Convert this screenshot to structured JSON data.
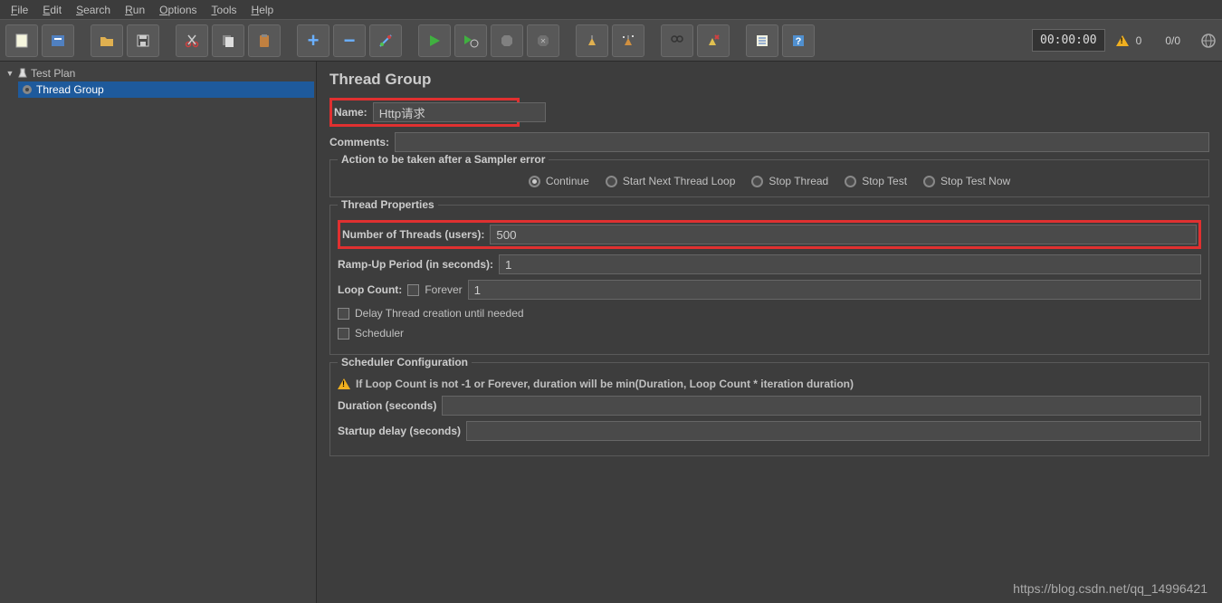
{
  "menu": {
    "file": "File",
    "edit": "Edit",
    "search": "Search",
    "run": "Run",
    "options": "Options",
    "tools": "Tools",
    "help": "Help"
  },
  "status": {
    "timer": "00:00:00",
    "warn": "0",
    "ratio": "0/0"
  },
  "tree": {
    "root": "Test Plan",
    "child": "Thread Group"
  },
  "panel": {
    "title": "Thread Group",
    "name_label": "Name:",
    "name_value": "Http请求",
    "comments_label": "Comments:",
    "action_legend": "Action to be taken after a Sampler error",
    "radios": {
      "continue": "Continue",
      "startnext": "Start Next Thread Loop",
      "stopthread": "Stop Thread",
      "stoptest": "Stop Test",
      "stoptestnow": "Stop Test Now"
    },
    "thread_legend": "Thread Properties",
    "num_threads_label": "Number of Threads (users):",
    "num_threads_value": "500",
    "rampup_label": "Ramp-Up Period (in seconds):",
    "rampup_value": "1",
    "loopcount_label": "Loop Count:",
    "forever_label": "Forever",
    "loopcount_value": "1",
    "delay_label": "Delay Thread creation until needed",
    "scheduler_label": "Scheduler",
    "sched_legend": "Scheduler Configuration",
    "sched_warning": "If Loop Count is not -1 or Forever, duration will be min(Duration, Loop Count * iteration duration)",
    "duration_label": "Duration (seconds)",
    "startup_label": "Startup delay (seconds)"
  },
  "watermark": "https://blog.csdn.net/qq_14996421"
}
